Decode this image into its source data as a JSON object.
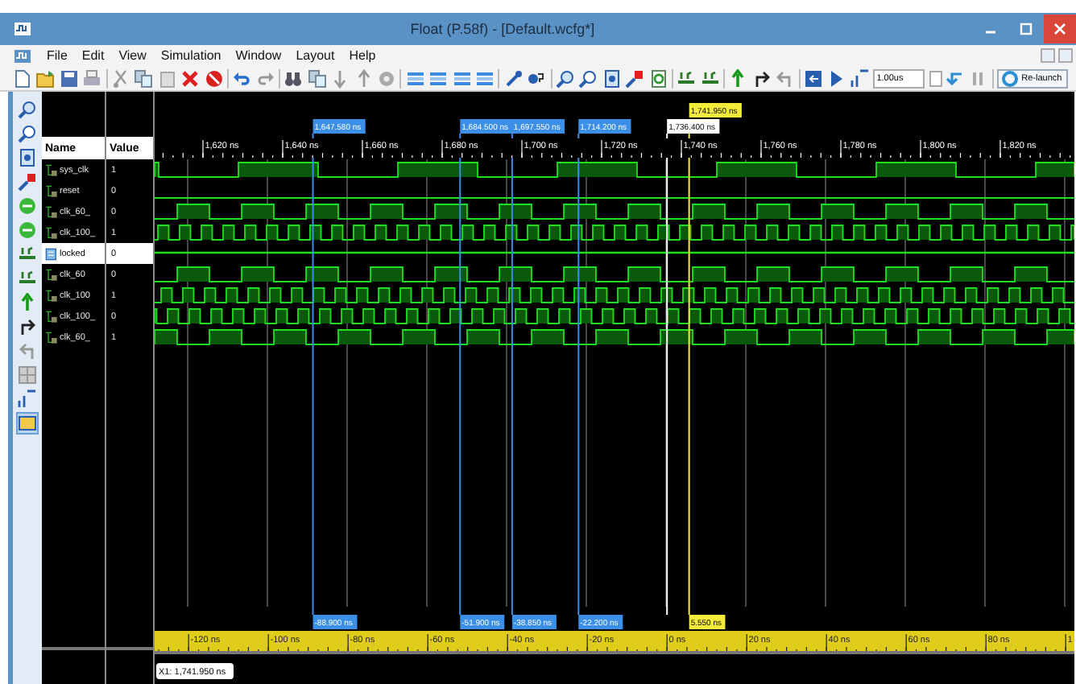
{
  "window": {
    "title": "Float (P.58f) - [Default.wcfg*]"
  },
  "menu": [
    "File",
    "Edit",
    "View",
    "Simulation",
    "Window",
    "Layout",
    "Help"
  ],
  "toolbar": {
    "time_field": {
      "value": "1.00us"
    },
    "relaunch_button": "Re-launch"
  },
  "columns": {
    "name": "Name",
    "value": "Value"
  },
  "signals": [
    {
      "name": "sys_clk",
      "value": "1",
      "kind": "bit",
      "selected": false
    },
    {
      "name": "reset",
      "value": "0",
      "kind": "bit",
      "selected": false
    },
    {
      "name": "clk_60_",
      "value": "0",
      "kind": "bit",
      "selected": false
    },
    {
      "name": "clk_100_",
      "value": "1",
      "kind": "bit",
      "selected": false
    },
    {
      "name": "locked",
      "value": "0",
      "kind": "port",
      "selected": true
    },
    {
      "name": "clk_60",
      "value": "0",
      "kind": "bit",
      "selected": false
    },
    {
      "name": "clk_100",
      "value": "1",
      "kind": "bit",
      "selected": false
    },
    {
      "name": "clk_100_",
      "value": "0",
      "kind": "bit",
      "selected": false
    },
    {
      "name": "clk_60_",
      "value": "1",
      "kind": "bit",
      "selected": false
    }
  ],
  "markers": [
    {
      "label": "1,741.950 ns",
      "kind": "cursor"
    },
    {
      "label": "1,647.580 ns",
      "kind": "marker"
    },
    {
      "label": "1,684.500 ns",
      "kind": "marker"
    },
    {
      "label": "1,697.550 ns",
      "kind": "marker"
    },
    {
      "label": "1,714.200 ns",
      "kind": "marker"
    },
    {
      "label": "1,736.400 ns",
      "kind": "reference"
    }
  ],
  "top_ruler": [
    "1,620 ns",
    "1,640 ns",
    "1,660 ns",
    "1,680 ns",
    "1,700 ns",
    "1,720 ns",
    "1,740 ns",
    "1,760 ns",
    "1,780 ns",
    "1,800 ns",
    "1,820 ns"
  ],
  "deltas": [
    {
      "label": "-88.900 ns",
      "kind": "marker"
    },
    {
      "label": "-51.900 ns",
      "kind": "marker"
    },
    {
      "label": "-38.850 ns",
      "kind": "marker"
    },
    {
      "label": "-22.200 ns",
      "kind": "marker"
    },
    {
      "label": "5.550 ns",
      "kind": "cursor"
    }
  ],
  "bottom_ruler": [
    "-120 ns",
    "-100 ns",
    "-80 ns",
    "-60 ns",
    "-40 ns",
    "-20 ns",
    "0 ns",
    "20 ns",
    "40 ns",
    "60 ns",
    "80 ns",
    "1"
  ],
  "status": "X1: 1,741.950 ns"
}
